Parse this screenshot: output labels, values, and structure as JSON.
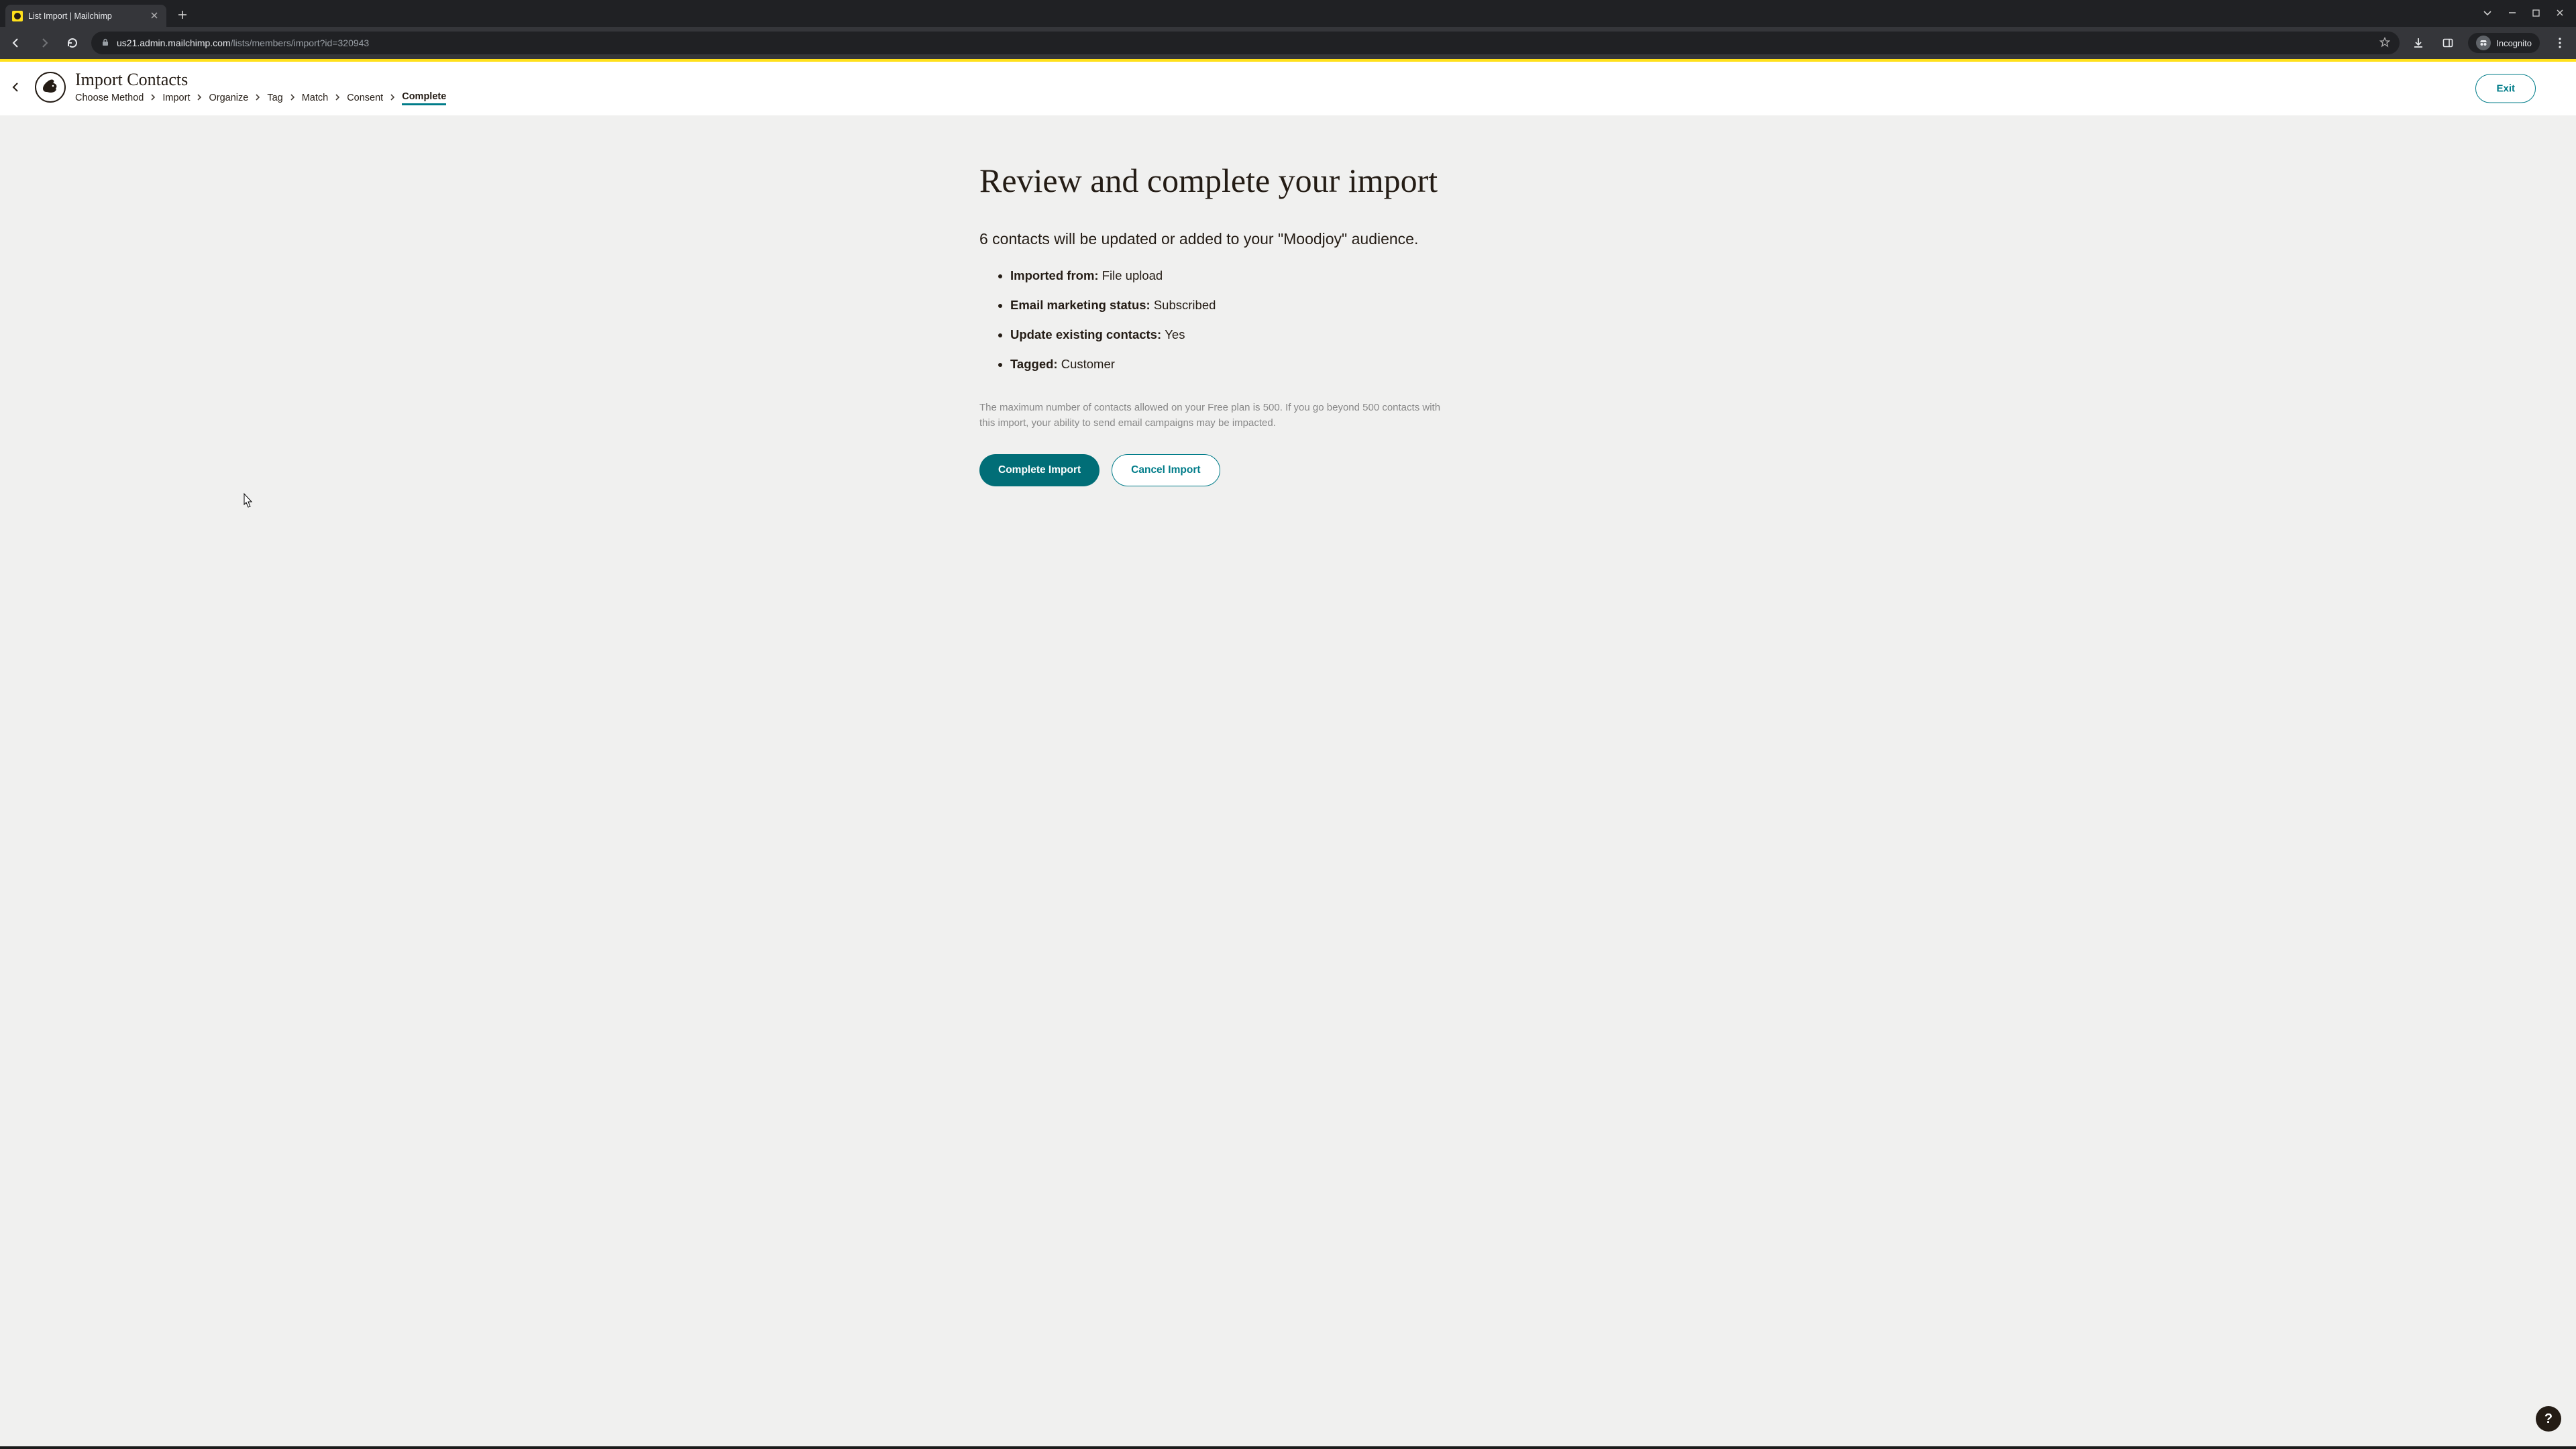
{
  "browser": {
    "tab_title": "List Import | Mailchimp",
    "url_host": "us21.admin.mailchimp.com",
    "url_path": "/lists/members/import?id=320943",
    "incognito_label": "Incognito"
  },
  "header": {
    "title": "Import Contacts",
    "exit_label": "Exit",
    "breadcrumb": [
      "Choose Method",
      "Import",
      "Organize",
      "Tag",
      "Match",
      "Consent",
      "Complete"
    ],
    "current_index": 6
  },
  "main": {
    "heading": "Review and complete your import",
    "summary": "6 contacts will be updated or added to your \"Moodjoy\" audience.",
    "details": [
      {
        "label": "Imported from:",
        "value": "File upload"
      },
      {
        "label": "Email marketing status:",
        "value": "Subscribed"
      },
      {
        "label": "Update existing contacts:",
        "value": "Yes"
      },
      {
        "label": "Tagged:",
        "value": "Customer"
      }
    ],
    "fineprint": "The maximum number of contacts allowed on your Free plan is 500. If you go beyond 500 contacts with this import, your ability to send email campaigns may be impacted.",
    "complete_label": "Complete Import",
    "cancel_label": "Cancel Import"
  },
  "help": {
    "label": "?"
  }
}
